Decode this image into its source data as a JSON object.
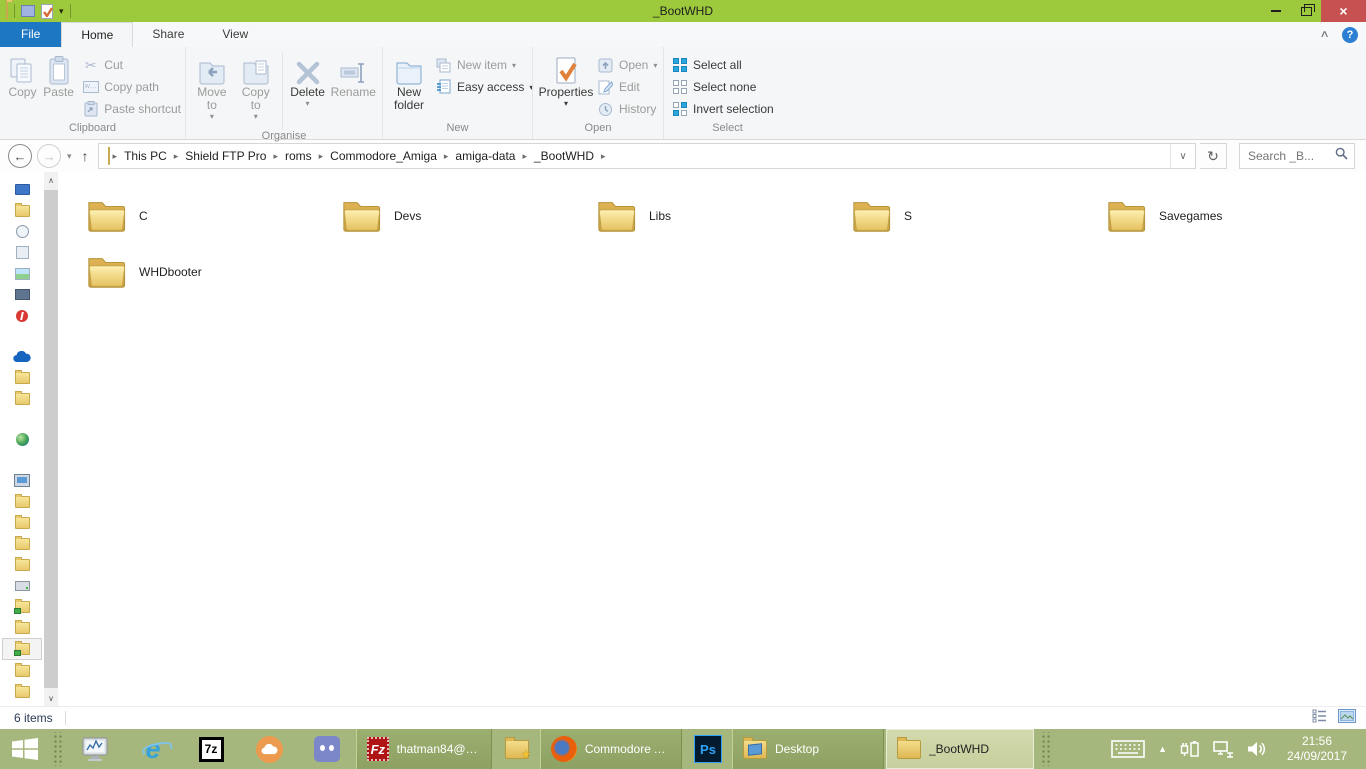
{
  "window": {
    "title": "_BootWHD"
  },
  "tabs": [
    {
      "label": "File"
    },
    {
      "label": "Home"
    },
    {
      "label": "Share"
    },
    {
      "label": "View"
    }
  ],
  "ribbon": {
    "clipboard": {
      "group": "Clipboard",
      "copy": "Copy",
      "paste": "Paste",
      "cut": "Cut",
      "copy_path": "Copy path",
      "paste_shortcut": "Paste shortcut"
    },
    "organise": {
      "group": "Organise",
      "move_to": "Move to",
      "copy_to": "Copy to",
      "delete": "Delete",
      "rename": "Rename"
    },
    "new": {
      "group": "New",
      "new_folder": "New folder",
      "new_item": "New item",
      "easy_access": "Easy access"
    },
    "open": {
      "group": "Open",
      "properties": "Properties",
      "open": "Open",
      "edit": "Edit",
      "history": "History"
    },
    "select": {
      "group": "Select",
      "select_all": "Select all",
      "select_none": "Select none",
      "invert": "Invert selection"
    }
  },
  "address": {
    "crumbs": [
      "This PC",
      "Shield FTP Pro",
      "roms",
      "Commodore_Amiga",
      "amiga-data",
      "_BootWHD"
    ],
    "search_placeholder": "Search _B..."
  },
  "folders": [
    {
      "name": "C"
    },
    {
      "name": "Devs"
    },
    {
      "name": "Libs"
    },
    {
      "name": "S"
    },
    {
      "name": "Savegames"
    },
    {
      "name": "WHDbooter"
    }
  ],
  "statusbar": {
    "item_count": "6 items"
  },
  "taskbar": {
    "filezilla_label": "thatman84@95....",
    "firefox_label": "Commodore A...",
    "desktop_label": "Desktop",
    "bootwhd_label": "_BootWHD",
    "clock": {
      "time": "21:56",
      "date": "24/09/2017"
    }
  },
  "glyphs": {
    "dropdown": "▾",
    "crumb_sep": "▸",
    "back": "←",
    "forward": "→",
    "up": "↑",
    "refresh": "↻",
    "chevron_up": "∧",
    "chevron_down": "∨",
    "help": "?",
    "cut": "✂",
    "sevenzip": "7z",
    "photoshop": "Ps",
    "filezilla": "Fz",
    "ie": "e",
    "tray_arrow": "▲"
  },
  "colors": {
    "titlebar_green": "#9dca3c",
    "taskbar_olive": "#a6b77e",
    "close_red": "#c75050",
    "file_tab_blue": "#1d77c3",
    "select_icon_blue": "#2aa7dd"
  }
}
